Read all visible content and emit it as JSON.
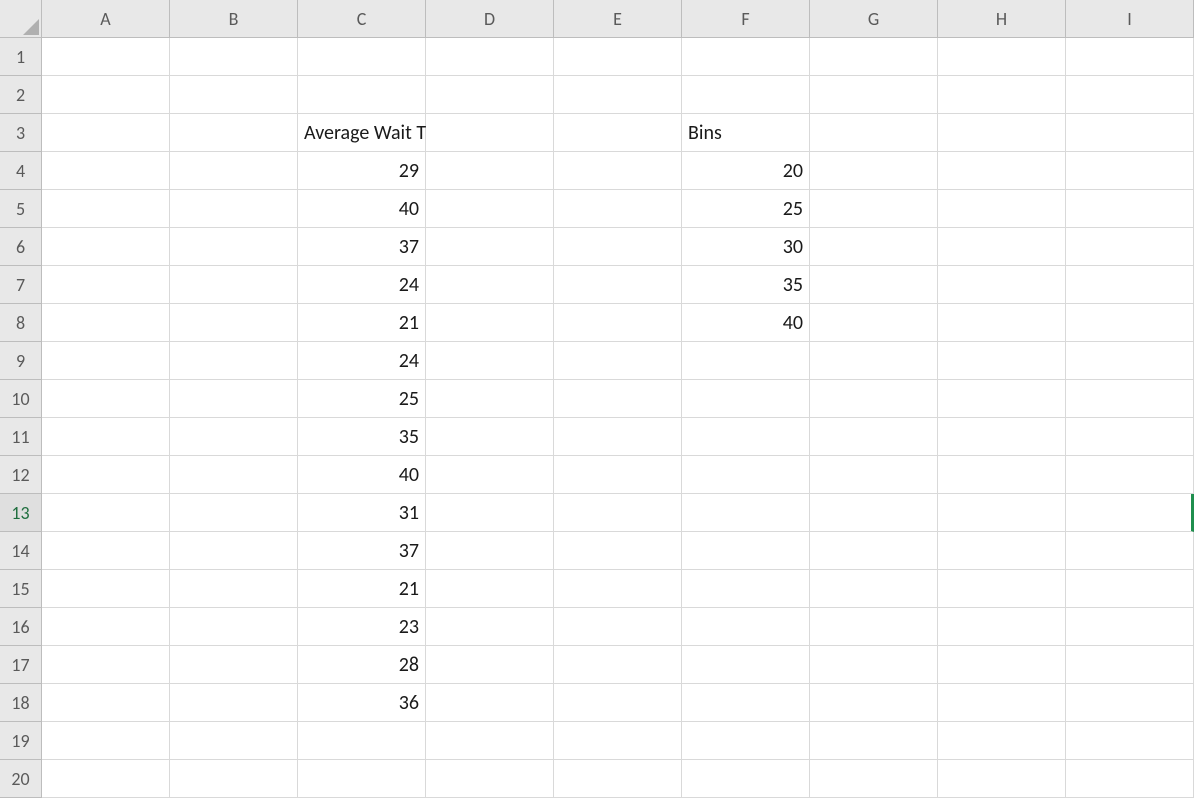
{
  "columns": [
    "A",
    "B",
    "C",
    "D",
    "E",
    "F",
    "G",
    "H",
    "I"
  ],
  "row_count": 20,
  "selected_row": 13,
  "headers": {
    "C3": "Average Wait Time",
    "F3": "Bins"
  },
  "data": {
    "C": {
      "4": "29",
      "5": "40",
      "6": "37",
      "7": "24",
      "8": "21",
      "9": "24",
      "10": "25",
      "11": "35",
      "12": "40",
      "13": "31",
      "14": "37",
      "15": "21",
      "16": "23",
      "17": "28",
      "18": "36"
    },
    "F": {
      "4": "20",
      "5": "25",
      "6": "30",
      "7": "35",
      "8": "40"
    }
  },
  "chart_data": {
    "type": "table",
    "series": [
      {
        "name": "Average Wait Time",
        "values": [
          29,
          40,
          37,
          24,
          21,
          24,
          25,
          35,
          40,
          31,
          37,
          21,
          23,
          28,
          36
        ]
      },
      {
        "name": "Bins",
        "values": [
          20,
          25,
          30,
          35,
          40
        ]
      }
    ]
  }
}
